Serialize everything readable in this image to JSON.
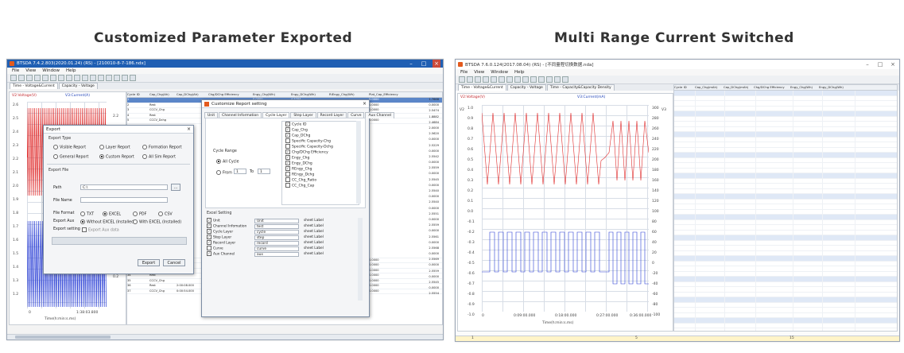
{
  "left_panel": {
    "heading": "Customized Parameter Exported",
    "window": {
      "title": "BTSDA 7.4.2.803(2020.01.24) (RS) - [210010-8-7-186.ndx]",
      "menu": [
        "File",
        "View",
        "Window",
        "Help"
      ],
      "tabs": [
        "Time - Voltage&Current",
        "Capacity - Voltage",
        "Cycle ID"
      ],
      "y_left_label": "V2:Voltage(V)",
      "y_right_label": "V3:Current(A)",
      "y_ticks_left": [
        "2.6",
        "2.5",
        "2.4",
        "2.3",
        "2.2",
        "2.1",
        "2.0",
        "1.9",
        "1.8",
        "1.7",
        "1.6",
        "1.5",
        "1.4",
        "1.3",
        "1.2"
      ],
      "y_ticks_right": [
        "2.2",
        "0.2"
      ],
      "x_ticks": [
        "0",
        "1:38:03.800"
      ],
      "x_label": "Time(h:min:s.ms)",
      "table_headers": [
        "Cycle ID",
        "Cap_Chg(Ah)",
        "Cap_DChg(Ah)",
        "Chg/DChg Efficiency",
        "Engy_Chg(Wh)",
        "Engy_DChg(Wh)",
        "RiEngy_Chg(Wh)",
        "Plat_Cap_Efficiency"
      ],
      "table_rows": [
        [
          "1",
          "",
          "",
          "",
          "0.0000",
          "4.5254",
          "",
          "0.0000"
        ],
        [
          "2",
          "Rest",
          "",
          "",
          "",
          "",
          "",
          "0.0000"
        ],
        [
          "3",
          "CCCV_Chg",
          "",
          "",
          "",
          "",
          "",
          "0.0000"
        ],
        [
          "4",
          "Rest",
          "",
          "",
          "",
          "",
          "",
          "0.0000"
        ],
        [
          "5",
          "CCCV_Dchg",
          "",
          "",
          "",
          "",
          "",
          "0.0000"
        ],
        [
          "31",
          "CCCV_Chg",
          "",
          "",
          "",
          "",
          "",
          "0.0000"
        ],
        [
          "32",
          "Rest",
          "",
          "",
          "",
          "",
          "",
          "0.0000"
        ],
        [
          "33",
          "CC_DChg",
          "",
          "",
          "",
          "",
          "",
          "0.0000"
        ],
        [
          "34",
          "Rest",
          "",
          "",
          "",
          "",
          "",
          "0.0000"
        ],
        [
          "35",
          "CCCV_Chg",
          "",
          "",
          "",
          "",
          "",
          "0.0000"
        ],
        [
          "36",
          "Rest",
          "2:00:08.000",
          "0.0000",
          "0.0000",
          "2.1035",
          "1.8287",
          "0.0000"
        ],
        [
          "37",
          "CCCV_Chg",
          "0:00:54.000",
          "0.0405",
          "0.0421",
          "2.5650",
          "2.5554",
          "0.0000"
        ]
      ],
      "right_values": [
        "1.7668",
        "0.0000",
        "2.5474",
        "1.8882",
        "2.4684",
        "2.0000",
        "2.5620",
        "0.0000",
        "2.5229",
        "0.0000",
        "2.5542",
        "0.0000",
        "2.5559",
        "0.0000",
        "2.5545",
        "0.0000",
        "2.5540",
        "0.0000",
        "2.5540",
        "0.0000",
        "2.5551",
        "0.0000",
        "2.5559",
        "0.0000",
        "2.5561",
        "0.0000",
        "2.5568",
        "0.0000",
        "2.5569",
        "0.0000",
        "2.5559",
        "0.0000",
        "2.5545",
        "0.0000",
        "2.5554"
      ]
    },
    "export_dialog": {
      "title": "Export",
      "report_type_label": "Export Type",
      "report_options": [
        "Visible Report",
        "Layer Report",
        "Formation Report",
        "General Report",
        "Custom Report",
        "All Sim Report"
      ],
      "export_file_label": "Export File",
      "path_label": "Path",
      "path_value": "C:\\",
      "file_name_label": "File Name",
      "file_format_label": "File Format",
      "file_formats": [
        "TXT",
        "EXCEL",
        "PDF",
        "CSV"
      ],
      "export_auxr_label": "Export Aux",
      "export_auxr_options": [
        "Without EXCEL (Installed)",
        "With EXCEL (Installed)"
      ],
      "export_setting_label": "Export setting",
      "export_aux_data": "Export Aux data",
      "export_button": "Export",
      "cancel_button": "Cancel"
    },
    "custom_dialog": {
      "title": "Customize Report setting",
      "tabs": [
        "Unit",
        "Channel Information",
        "Cycle Layer",
        "Step Layer",
        "Record Layer",
        "Curve",
        "Aux Channel"
      ],
      "cycle_range_label": "Cycle Range",
      "all_cycle": "All Cycle",
      "from_label": "From",
      "from_value": "1",
      "to_label": "To",
      "to_value": "1",
      "params": [
        "Cycle ID",
        "Cap_Chg",
        "Cap_DChg",
        "Specific Capacity-Chg",
        "Specific Capacity-Dchg",
        "Chg/DChg Efficiency",
        "Engy_Chg",
        "Engy_DChg",
        "REngy_Chg",
        "REngy_Dchg",
        "CC_Chg_Ratio",
        "CC_Chg_Cap"
      ],
      "params_checked": [
        true,
        true,
        true,
        false,
        false,
        true,
        true,
        true,
        true,
        false,
        false,
        false
      ],
      "excel_setting_label": "Excel Setting",
      "excel_rows": [
        {
          "name": "Unit",
          "value": "Unit",
          "target": "sheet Label",
          "checked": true
        },
        {
          "name": "Channel Infomation",
          "value": "test",
          "target": "sheet Label",
          "checked": true
        },
        {
          "name": "Cycle Layer",
          "value": "cycle",
          "target": "sheet Label",
          "checked": true
        },
        {
          "name": "Step Layer",
          "value": "step",
          "target": "sheet Label",
          "checked": true
        },
        {
          "name": "Record Layer",
          "value": "record",
          "target": "sheet Label",
          "checked": true
        },
        {
          "name": "Curve",
          "value": "curve",
          "target": "sheet Label",
          "checked": false
        },
        {
          "name": "Aux Channel",
          "value": "aux",
          "target": "sheet Label",
          "checked": true
        }
      ]
    }
  },
  "right_panel": {
    "heading": "Multi Range Current Switched",
    "window": {
      "title": "BTSDA 7.6.0.124(2017.08.04) (RS) - [不同量程切换数据.nda]",
      "menu": [
        "File",
        "View",
        "Window",
        "Help"
      ],
      "tabs": [
        "Time - Voltage&Current",
        "Capacity - Voltage",
        "Time - Capacity&Capacity Density"
      ],
      "y_left_label": "V2:Voltage(V)",
      "y_right_label": "V3:Current(mA)",
      "y_ticks_left": [
        "1.0",
        "0.9",
        "0.8",
        "0.7",
        "0.6",
        "0.5",
        "0.4",
        "0.3",
        "0.2",
        "0.1",
        "0.0",
        "-0.1",
        "-0.2",
        "-0.3",
        "-0.4",
        "-0.5",
        "-0.6",
        "-0.7",
        "-0.8",
        "-0.9",
        "-1.0"
      ],
      "y_ticks_right": [
        "300",
        "280",
        "260",
        "240",
        "220",
        "200",
        "180",
        "160",
        "140",
        "120",
        "100",
        "80",
        "60",
        "40",
        "20",
        "0",
        "-20",
        "-40",
        "-60",
        "-80",
        "-100"
      ],
      "x_ticks": [
        "0",
        "0:09:00.000",
        "0:18:00.000",
        "0:27:00.000",
        "0:36:00.000"
      ],
      "x_label": "Time(h:min:s.ms)",
      "table_headers": [
        "Cycle ID",
        "Cap_Chg(mAh)",
        "Cap_DChg(mAh)",
        "Chg/DChg Efficiency",
        "Engy_Chg(Wh)",
        "Engy_DChg(Wh)"
      ],
      "scroll_labels": [
        "1",
        "5",
        "15"
      ]
    }
  }
}
